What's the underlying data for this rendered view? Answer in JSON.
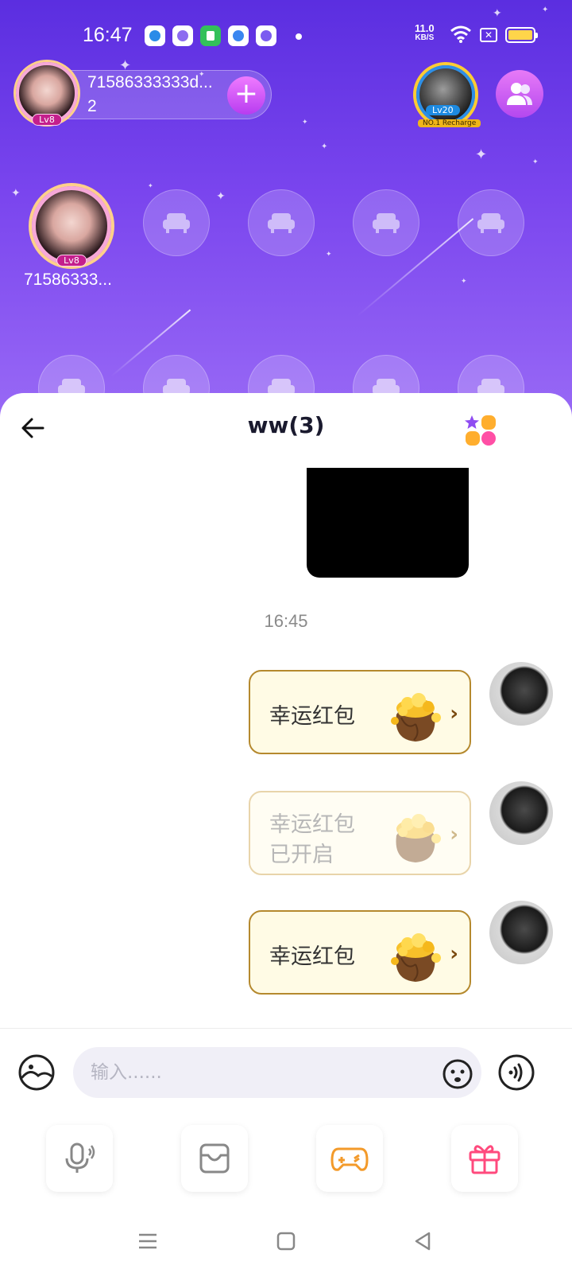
{
  "status_bar": {
    "time": "16:47",
    "net_speed_value": "11.0",
    "net_speed_unit": "KB/S",
    "icons": [
      "app-icon-1",
      "app-icon-2",
      "app-icon-3",
      "app-icon-4",
      "app-icon-5",
      "wifi-icon",
      "sim-icon",
      "battery-icon"
    ]
  },
  "room": {
    "host_name": "71586333333d...",
    "host_count": "2",
    "host_level": "Lv8",
    "top_right_level": "Lv20",
    "top_right_tag": "NO.1 Recharge",
    "seats": {
      "occupied": {
        "name": "71586333...",
        "level": "Lv8"
      },
      "empty_count": 9
    }
  },
  "chat": {
    "title": "ww(3)",
    "timestamp": "16:45",
    "messages": [
      {
        "type": "red_packet",
        "line1": "幸运红包",
        "line2": "",
        "state": "unopened"
      },
      {
        "type": "red_packet",
        "line1": "幸运红包",
        "line2": "已开启",
        "state": "opened"
      },
      {
        "type": "red_packet",
        "line1": "幸运红包",
        "line2": "",
        "state": "unopened"
      }
    ]
  },
  "input_bar": {
    "placeholder": "输入......"
  },
  "tools": [
    "mic-icon",
    "album-icon",
    "game-icon",
    "gift-icon"
  ],
  "colors": {
    "room_bg_top": "#5b2ee0",
    "room_bg_bottom": "#9a6bf6",
    "accent_pink": "#ef7bff",
    "red_packet_bg": "#fffbe5",
    "red_packet_border": "#b5892e"
  }
}
